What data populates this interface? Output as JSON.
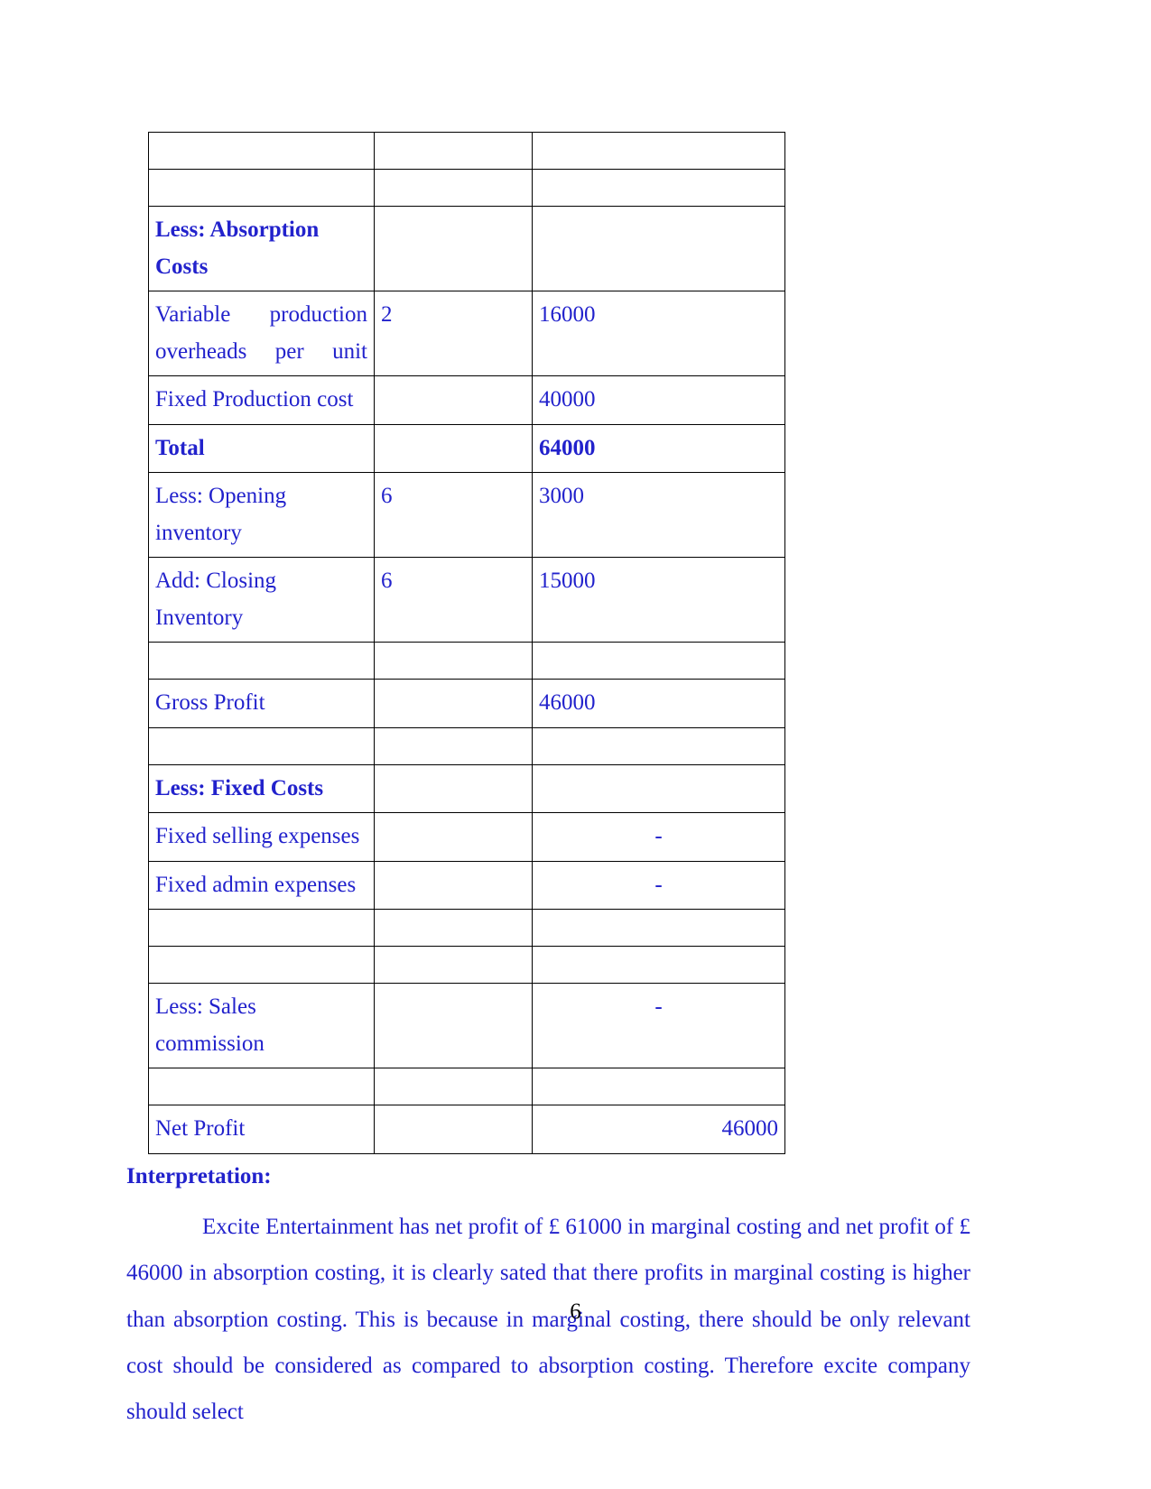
{
  "document": {
    "page_number": "6",
    "text_color": "#2222cc",
    "border_color": "#000000"
  },
  "table": {
    "rows": [
      {
        "label": "",
        "units": "",
        "amount": "",
        "label_bold": false,
        "amount_bold": false,
        "amount_align": "left",
        "empty": true
      },
      {
        "label": "",
        "units": "",
        "amount": "",
        "label_bold": false,
        "amount_bold": false,
        "amount_align": "left",
        "empty": true
      },
      {
        "label": "Less: Absorption Costs",
        "units": "",
        "amount": "",
        "label_bold": true,
        "amount_bold": false,
        "amount_align": "left",
        "empty": false
      },
      {
        "label": "Variable production overheads per unit",
        "units": "2",
        "amount": "16000",
        "label_bold": false,
        "amount_bold": false,
        "amount_align": "left",
        "empty": false
      },
      {
        "label": "Fixed Production cost",
        "units": "",
        "amount": "40000",
        "label_bold": false,
        "amount_bold": false,
        "amount_align": "left",
        "empty": false
      },
      {
        "label": "Total",
        "units": "",
        "amount": "64000",
        "label_bold": true,
        "amount_bold": true,
        "amount_align": "left",
        "empty": false
      },
      {
        "label": "Less: Opening inventory",
        "units": "6",
        "amount": "3000",
        "label_bold": false,
        "amount_bold": false,
        "amount_align": "left",
        "empty": false
      },
      {
        "label": "Add: Closing Inventory",
        "units": "6",
        "amount": "15000",
        "label_bold": false,
        "amount_bold": false,
        "amount_align": "left",
        "empty": false
      },
      {
        "label": "",
        "units": "",
        "amount": "",
        "label_bold": false,
        "amount_bold": false,
        "amount_align": "left",
        "empty": true
      },
      {
        "label": "Gross Profit",
        "units": "",
        "amount": "46000",
        "label_bold": false,
        "amount_bold": false,
        "amount_align": "left",
        "empty": false
      },
      {
        "label": "",
        "units": "",
        "amount": "",
        "label_bold": false,
        "amount_bold": false,
        "amount_align": "left",
        "empty": true
      },
      {
        "label": "Less: Fixed Costs",
        "units": "",
        "amount": "",
        "label_bold": true,
        "amount_bold": false,
        "amount_align": "left",
        "empty": false
      },
      {
        "label": "Fixed selling expenses",
        "units": "",
        "amount": "-",
        "label_bold": false,
        "amount_bold": false,
        "amount_align": "center",
        "empty": false
      },
      {
        "label": "Fixed admin expenses",
        "units": "",
        "amount": "-",
        "label_bold": false,
        "amount_bold": false,
        "amount_align": "center",
        "empty": false
      },
      {
        "label": "",
        "units": "",
        "amount": "",
        "label_bold": false,
        "amount_bold": false,
        "amount_align": "left",
        "empty": true
      },
      {
        "label": "",
        "units": "",
        "amount": "",
        "label_bold": false,
        "amount_bold": false,
        "amount_align": "left",
        "empty": true
      },
      {
        "label": "Less: Sales commission",
        "units": "",
        "amount": "-",
        "label_bold": false,
        "amount_bold": false,
        "amount_align": "center",
        "empty": false
      },
      {
        "label": "",
        "units": "",
        "amount": "",
        "label_bold": false,
        "amount_bold": false,
        "amount_align": "left",
        "empty": true
      },
      {
        "label": "Net Profit",
        "units": "",
        "amount": "46000",
        "label_bold": false,
        "amount_bold": false,
        "amount_align": "right",
        "empty": false
      }
    ]
  },
  "interpretation": {
    "heading": "Interpretation:",
    "paragraph": "Excite Entertainment has net profit of £ 61000 in marginal costing and net profit of £ 46000 in absorption costing, it is clearly sated that there profits in marginal costing is higher than absorption costing. This is because in marginal costing, there should be only relevant cost should be considered as compared to absorption costing. Therefore excite company should select"
  }
}
